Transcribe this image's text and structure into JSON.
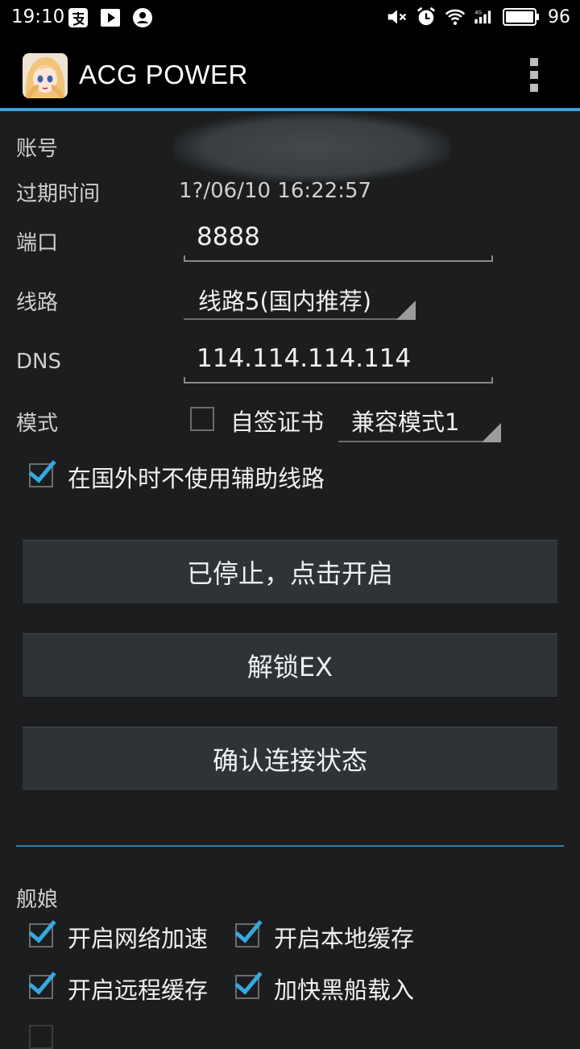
{
  "status_bar": {
    "time": "19:10",
    "battery": "96",
    "network": "4G",
    "left_icons": [
      "alipay-icon",
      "video-play-icon",
      "account-icon"
    ],
    "right_icons": [
      "mute-icon",
      "alarm-icon",
      "wifi-icon",
      "signal-icon",
      "battery-icon"
    ]
  },
  "app_bar": {
    "title": "ACG POWER"
  },
  "form": {
    "account_label": "账号",
    "expire_label": "过期时间",
    "expire_value": "1?/06/10 16:22:57",
    "port_label": "端口",
    "port_value": "8888",
    "route_label": "线路",
    "route_value": "线路5(国内推荐)",
    "dns_label": "DNS",
    "dns_value": "114.114.114.114",
    "mode_label": "模式",
    "self_signed_label": "自签证书",
    "self_signed_checked": false,
    "mode_value": "兼容模式1",
    "abroad_label": "在国外时不使用辅助线路",
    "abroad_checked": true
  },
  "buttons": {
    "start": "已停止，点击开启",
    "unlock": "解锁EX",
    "check": "确认连接状态"
  },
  "kancolle": {
    "title": "舰娘",
    "options": [
      {
        "label": "开启网络加速",
        "checked": true
      },
      {
        "label": "开启本地缓存",
        "checked": true
      },
      {
        "label": "开启远程缓存",
        "checked": true
      },
      {
        "label": "加快黑船载入",
        "checked": true
      }
    ]
  },
  "colors": {
    "accent": "#35a9e0",
    "background": "#1b1d1e",
    "button": "#2f3337"
  }
}
